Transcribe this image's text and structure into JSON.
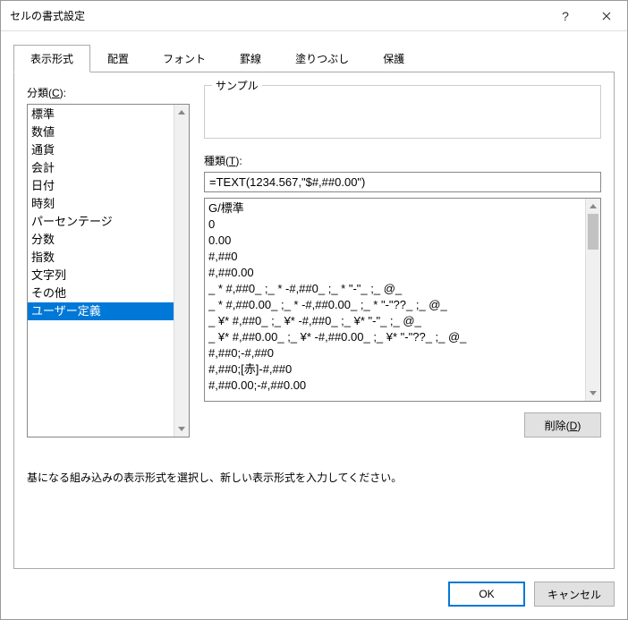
{
  "title": "セルの書式設定",
  "tabs": [
    "表示形式",
    "配置",
    "フォント",
    "罫線",
    "塗りつぶし",
    "保護"
  ],
  "activeTab": 0,
  "category": {
    "label": "分類(C): ",
    "items": [
      "標準",
      "数値",
      "通貨",
      "会計",
      "日付",
      "時刻",
      "パーセンテージ",
      "分数",
      "指数",
      "文字列",
      "その他",
      "ユーザー定義"
    ],
    "selectedIndex": 11
  },
  "sample": {
    "legend": "サンプル",
    "value": ""
  },
  "type": {
    "label": "種類(T): ",
    "value": "=TEXT(1234.567,\"$#,##0.00\")",
    "items": [
      "G/標準",
      "0",
      "0.00",
      "#,##0",
      "#,##0.00",
      "_ * #,##0_ ;_ * -#,##0_ ;_ * \"-\"_ ;_ @_",
      "_ * #,##0.00_ ;_ * -#,##0.00_ ;_ * \"-\"??_ ;_ @_",
      "_ ¥* #,##0_ ;_ ¥* -#,##0_ ;_ ¥* \"-\"_ ;_ @_",
      "_ ¥* #,##0.00_ ;_ ¥* -#,##0.00_ ;_ ¥* \"-\"??_ ;_ @_",
      "#,##0;-#,##0",
      "#,##0;[赤]-#,##0",
      "#,##0.00;-#,##0.00"
    ]
  },
  "delete": "削除(D)",
  "hint": "基になる組み込みの表示形式を選択し、新しい表示形式を入力してください。",
  "ok": "OK",
  "cancel": "キャンセル"
}
